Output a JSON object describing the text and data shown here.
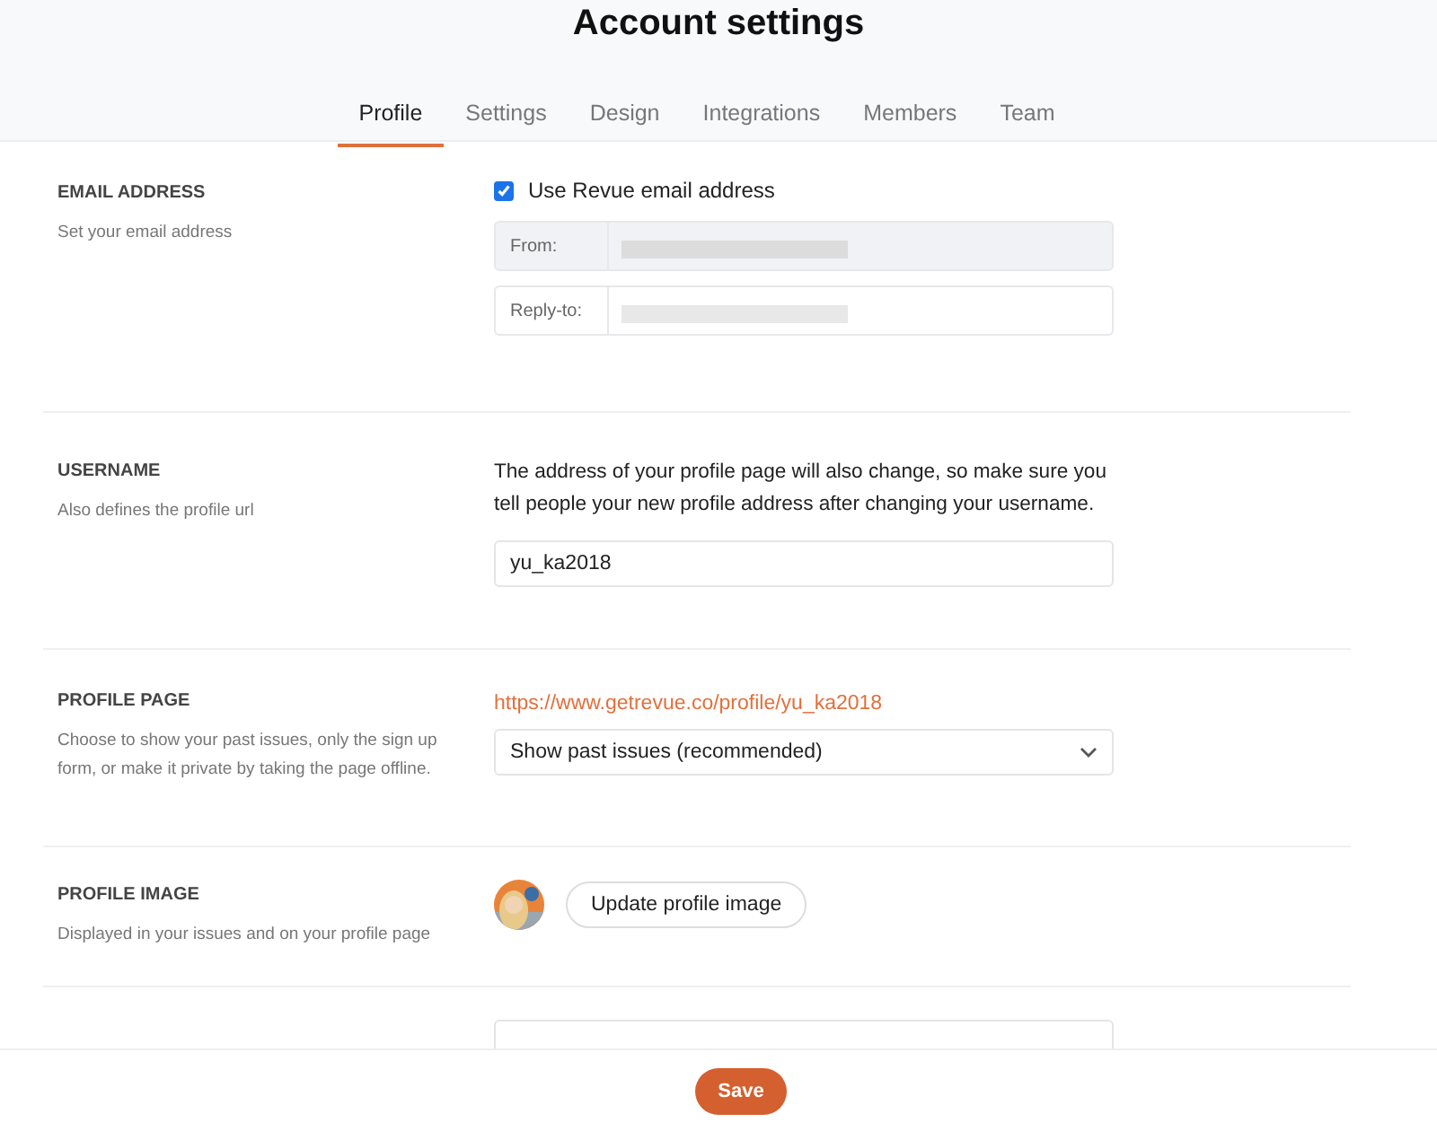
{
  "page": {
    "title": "Account settings"
  },
  "tabs": [
    {
      "label": "Profile",
      "selected": true
    },
    {
      "label": "Settings",
      "selected": false
    },
    {
      "label": "Design",
      "selected": false
    },
    {
      "label": "Integrations",
      "selected": false
    },
    {
      "label": "Members",
      "selected": false
    },
    {
      "label": "Team",
      "selected": false
    }
  ],
  "sections": [
    {
      "kind": "email",
      "label": "EMAIL ADDRESS",
      "description": "Set your email address",
      "checkbox": {
        "label": "Use Revue email address",
        "checked": true
      },
      "fields": [
        {
          "label": "From:",
          "disabled": true
        },
        {
          "label": "Reply-to:",
          "disabled": false
        }
      ]
    },
    {
      "kind": "username",
      "label": "USERNAME",
      "description": "Also defines the profile url",
      "notice": "The address of your profile page will also change, so make sure you tell people your new profile address after changing your username.",
      "value": "yu_ka2018"
    },
    {
      "kind": "profile_page",
      "label": "PROFILE PAGE",
      "description": "Choose to show your past issues, only the sign up form, or make it private by taking the page offline.",
      "link": "https://www.getrevue.co/profile/yu_ka2018",
      "select": "Show past issues (recommended)"
    },
    {
      "kind": "profile_image",
      "label": "PROFILE IMAGE",
      "description": "Displayed in your issues and on your profile page",
      "button": "Update profile image"
    },
    {
      "kind": "partial"
    }
  ],
  "footer": {
    "button": "Save"
  }
}
